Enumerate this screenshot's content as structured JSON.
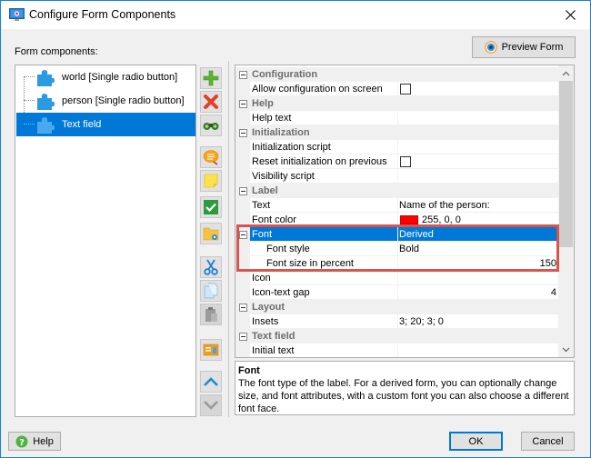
{
  "window": {
    "title": "Configure Form Components",
    "app_icon": "monitor-icon",
    "close_icon": "close-icon"
  },
  "left": {
    "label": "Form components:",
    "tree": [
      {
        "label": "world [Single radio button]",
        "icon": "puzzle-icon",
        "selected": false
      },
      {
        "label": "person [Single radio button]",
        "icon": "puzzle-icon",
        "selected": false
      },
      {
        "label": "Text field",
        "icon": "puzzle-icon",
        "selected": true
      }
    ]
  },
  "toolbar": {
    "buttons": [
      {
        "name": "add",
        "icon": "plus-icon",
        "enabled": true
      },
      {
        "name": "delete",
        "icon": "delete-x-icon",
        "enabled": true
      },
      {
        "name": "find",
        "icon": "binoculars-icon",
        "enabled": true
      },
      {
        "name": "comment",
        "icon": "speech-bubble-icon",
        "enabled": true
      },
      {
        "name": "note",
        "icon": "sticky-note-icon",
        "enabled": true
      },
      {
        "name": "check",
        "icon": "checkmark-icon",
        "enabled": true
      },
      {
        "name": "folder-settings",
        "icon": "folder-gear-icon",
        "enabled": true
      },
      {
        "name": "cut",
        "icon": "scissors-icon",
        "enabled": true
      },
      {
        "name": "copy",
        "icon": "copy-icon",
        "enabled": true
      },
      {
        "name": "paste",
        "icon": "paste-icon",
        "enabled": false
      },
      {
        "name": "form-preview",
        "icon": "form-image-icon",
        "enabled": true
      },
      {
        "name": "move-up",
        "icon": "chevron-up-icon",
        "enabled": true
      },
      {
        "name": "move-down",
        "icon": "chevron-down-icon",
        "enabled": false
      }
    ]
  },
  "preview_button": {
    "label": "Preview Form",
    "icon": "eye-icon"
  },
  "properties": {
    "rows": [
      {
        "type": "category",
        "name": "Configuration"
      },
      {
        "type": "prop",
        "name": "Allow configuration on screen",
        "value_type": "checkbox",
        "checked": false
      },
      {
        "type": "category",
        "name": "Help"
      },
      {
        "type": "prop",
        "name": "Help text",
        "value": ""
      },
      {
        "type": "category",
        "name": "Initialization"
      },
      {
        "type": "prop",
        "name": "Initialization script",
        "value": ""
      },
      {
        "type": "prop",
        "name": "Reset initialization on previous",
        "value_type": "checkbox",
        "checked": false
      },
      {
        "type": "prop",
        "name": "Visibility script",
        "value": ""
      },
      {
        "type": "category",
        "name": "Label"
      },
      {
        "type": "prop",
        "name": "Text",
        "value": "Name of the person:"
      },
      {
        "type": "prop",
        "name": "Font color",
        "value_type": "color",
        "value": "255, 0, 0",
        "color": "#ff0000"
      },
      {
        "type": "prop-group",
        "name": "Font",
        "value": "Derived",
        "selected": true
      },
      {
        "type": "prop",
        "name": "Font style",
        "value": "Bold",
        "indent": true
      },
      {
        "type": "prop",
        "name": "Font size in percent",
        "value": "150",
        "indent": true,
        "align": "right"
      },
      {
        "type": "prop",
        "name": "Icon",
        "value": ""
      },
      {
        "type": "prop",
        "name": "Icon-text gap",
        "value": "4",
        "align": "right"
      },
      {
        "type": "category",
        "name": "Layout"
      },
      {
        "type": "prop",
        "name": "Insets",
        "value": "3; 20; 3; 0"
      },
      {
        "type": "category",
        "name": "Text field"
      },
      {
        "type": "prop",
        "name": "Initial text",
        "value": ""
      }
    ]
  },
  "description": {
    "title": "Font",
    "text": "The font type of the label. For a derived form, you can optionally change size, and font attributes, with a custom font you can also choose a different font face."
  },
  "footer": {
    "help_label": "Help",
    "ok_label": "OK",
    "cancel_label": "Cancel"
  },
  "colors": {
    "accent": "#0078d7",
    "highlight_border": "#d9534f"
  }
}
